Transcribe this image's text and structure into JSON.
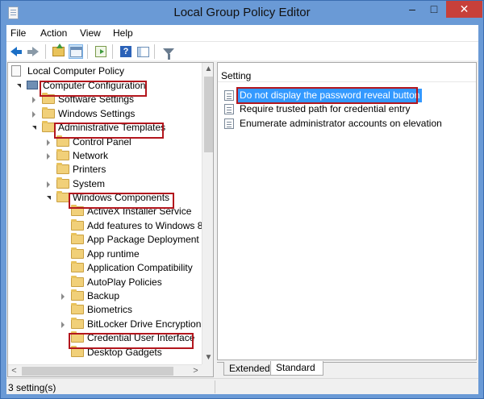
{
  "window": {
    "title": "Local Group Policy Editor"
  },
  "titlebar_buttons": {
    "minimize": "–",
    "maximize": "□",
    "close": "✕"
  },
  "menu": [
    "File",
    "Action",
    "View",
    "Help"
  ],
  "tree": [
    {
      "label": "Local Computer Policy",
      "icon": "policy-doc-icon",
      "exp": ""
    },
    {
      "label": "Computer Configuration",
      "icon": "computer-icon",
      "exp": "expanded"
    },
    {
      "label": "Software Settings",
      "icon": "folder-icon",
      "exp": "collapsed"
    },
    {
      "label": "Windows Settings",
      "icon": "folder-icon",
      "exp": "collapsed"
    },
    {
      "label": "Administrative Templates",
      "icon": "folder-icon",
      "exp": "expanded"
    },
    {
      "label": "Control Panel",
      "icon": "folder-icon",
      "exp": "collapsed"
    },
    {
      "label": "Network",
      "icon": "folder-icon",
      "exp": "collapsed"
    },
    {
      "label": "Printers",
      "icon": "folder-icon",
      "exp": ""
    },
    {
      "label": "System",
      "icon": "folder-icon",
      "exp": "collapsed"
    },
    {
      "label": "Windows Components",
      "icon": "folder-icon",
      "exp": "expanded"
    },
    {
      "label": "ActiveX Installer Service",
      "icon": "folder-icon",
      "exp": ""
    },
    {
      "label": "Add features to Windows 8",
      "icon": "folder-icon",
      "exp": ""
    },
    {
      "label": "App Package Deployment",
      "icon": "folder-icon",
      "exp": ""
    },
    {
      "label": "App runtime",
      "icon": "folder-icon",
      "exp": ""
    },
    {
      "label": "Application Compatibility",
      "icon": "folder-icon",
      "exp": ""
    },
    {
      "label": "AutoPlay Policies",
      "icon": "folder-icon",
      "exp": ""
    },
    {
      "label": "Backup",
      "icon": "folder-icon",
      "exp": "collapsed"
    },
    {
      "label": "Biometrics",
      "icon": "folder-icon",
      "exp": ""
    },
    {
      "label": "BitLocker Drive Encryption",
      "icon": "folder-icon",
      "exp": "collapsed"
    },
    {
      "label": "Credential User Interface",
      "icon": "folder-icon",
      "exp": ""
    },
    {
      "label": "Desktop Gadgets",
      "icon": "folder-icon",
      "exp": ""
    }
  ],
  "settings_header": "Setting",
  "settings": [
    "Do not display the password reveal button",
    "Require trusted path for credential entry",
    "Enumerate administrator accounts on elevation"
  ],
  "tabs": [
    "Extended",
    "Standard"
  ],
  "status": "3 setting(s)",
  "colors": {
    "titlebar": "#6a9ad6",
    "close_button": "#c7403a",
    "selection": "#3399ff",
    "highlight_box": "#b3161d"
  }
}
